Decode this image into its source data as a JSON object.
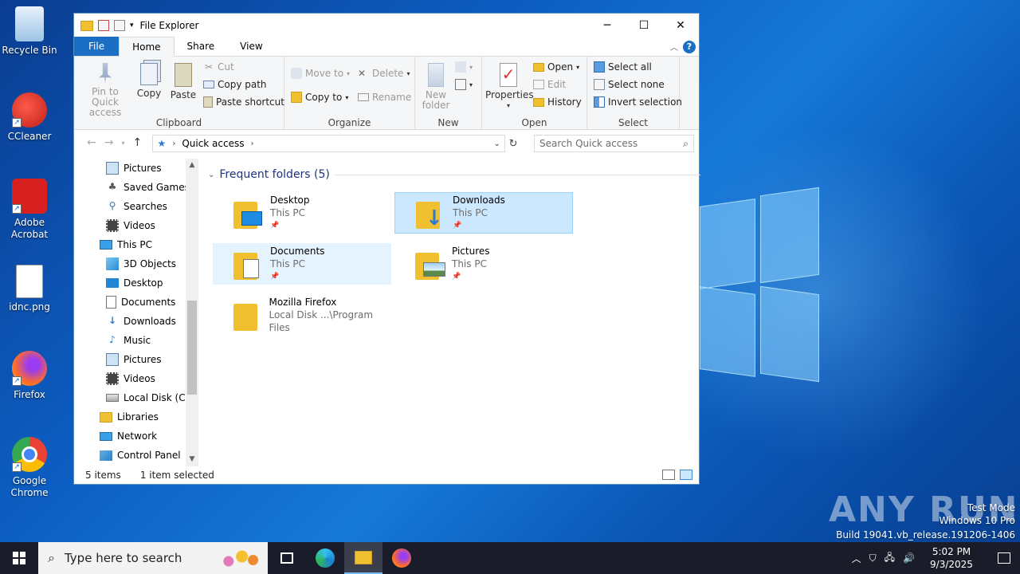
{
  "desktop": {
    "icons": [
      {
        "label": "Recycle Bin"
      },
      {
        "label": "CCleaner"
      },
      {
        "label": "Adobe Acrobat"
      },
      {
        "label": "idnc.png"
      },
      {
        "label": "Firefox"
      },
      {
        "label": "Google Chrome"
      }
    ],
    "watermark": {
      "brand": "ANY RUN",
      "line1": "Test Mode",
      "line2": "Windows 10 Pro",
      "line3": "Build 19041.vb_release.191206-1406"
    }
  },
  "window": {
    "title": "File Explorer",
    "tabs": [
      "File",
      "Home",
      "Share",
      "View"
    ],
    "ribbon": {
      "clipboard": {
        "label": "Clipboard",
        "pin": "Pin to Quick access",
        "copy": "Copy",
        "paste": "Paste",
        "cut": "Cut",
        "copy_path": "Copy path",
        "paste_shortcut": "Paste shortcut"
      },
      "organize": {
        "label": "Organize",
        "move_to": "Move to",
        "copy_to": "Copy to",
        "delete": "Delete",
        "rename": "Rename"
      },
      "new": {
        "label": "New",
        "new_folder": "New folder"
      },
      "open": {
        "label": "Open",
        "properties": "Properties",
        "open": "Open",
        "edit": "Edit",
        "history": "History"
      },
      "select": {
        "label": "Select",
        "select_all": "Select all",
        "select_none": "Select none",
        "invert": "Invert selection"
      }
    },
    "address": {
      "location": "Quick access"
    },
    "search": {
      "placeholder": "Search Quick access"
    },
    "tree": [
      {
        "label": "Pictures",
        "icon": "pictures-icon"
      },
      {
        "label": "Saved Games",
        "icon": "saved-games-icon"
      },
      {
        "label": "Searches",
        "icon": "searches-icon"
      },
      {
        "label": "Videos",
        "icon": "videos-icon"
      },
      {
        "label": "This PC",
        "icon": "this-pc-icon"
      },
      {
        "label": "3D Objects",
        "icon": "3d-objects-icon"
      },
      {
        "label": "Desktop",
        "icon": "desktop-icon"
      },
      {
        "label": "Documents",
        "icon": "documents-icon"
      },
      {
        "label": "Downloads",
        "icon": "downloads-icon"
      },
      {
        "label": "Music",
        "icon": "music-icon"
      },
      {
        "label": "Pictures",
        "icon": "pictures-icon"
      },
      {
        "label": "Videos",
        "icon": "videos-icon"
      },
      {
        "label": "Local Disk (C:)",
        "icon": "local-disk-icon"
      },
      {
        "label": "Libraries",
        "icon": "libraries-icon"
      },
      {
        "label": "Network",
        "icon": "network-icon"
      },
      {
        "label": "Control Panel",
        "icon": "control-panel-icon"
      }
    ],
    "frequent_header": "Frequent folders (5)",
    "folders": [
      {
        "name": "Desktop",
        "sub": "This PC",
        "pinned": true
      },
      {
        "name": "Downloads",
        "sub": "This PC",
        "pinned": true
      },
      {
        "name": "Documents",
        "sub": "This PC",
        "pinned": true
      },
      {
        "name": "Pictures",
        "sub": "This PC",
        "pinned": true
      },
      {
        "name": "Mozilla Firefox",
        "sub": "Local Disk ...\\Program Files",
        "pinned": false
      }
    ],
    "status": {
      "items": "5 items",
      "selected": "1 item selected"
    }
  },
  "taskbar": {
    "search_placeholder": "Type here to search",
    "time": "5:02 PM",
    "date": "9/3/2025"
  }
}
